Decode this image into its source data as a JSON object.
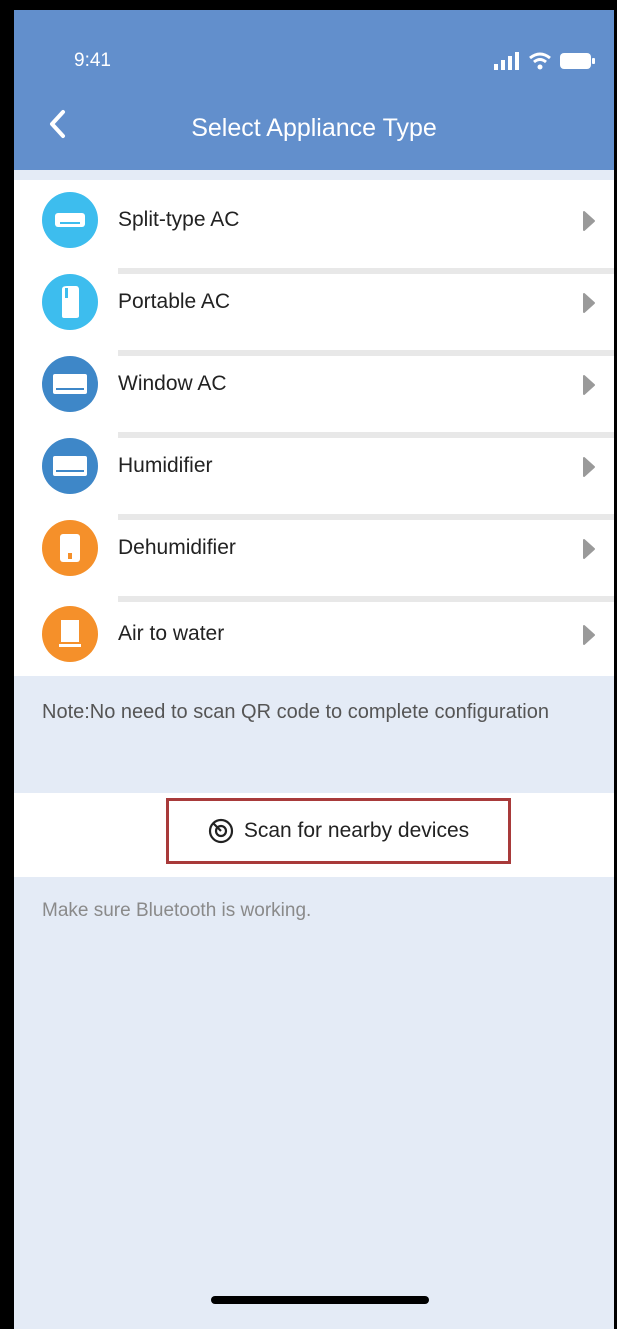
{
  "status_bar": {
    "time": "9:41"
  },
  "header": {
    "title": "Select Appliance Type"
  },
  "appliances": [
    {
      "label": "Split-type AC",
      "icon": "split-ac-icon",
      "color": "#3dbdee"
    },
    {
      "label": "Portable AC",
      "icon": "portable-ac-icon",
      "color": "#3dbdee"
    },
    {
      "label": "Window AC",
      "icon": "window-ac-icon",
      "color": "#3e87c8"
    },
    {
      "label": "Humidifier",
      "icon": "humidifier-icon",
      "color": "#3e87c8"
    },
    {
      "label": "Dehumidifier",
      "icon": "dehumidifier-icon",
      "color": "#f5902a"
    },
    {
      "label": "Air to water",
      "icon": "air-to-water-icon",
      "color": "#f5902a"
    }
  ],
  "note": "Note:No need to scan QR code to complete configuration",
  "scan": {
    "label": "Scan for nearby devices"
  },
  "hint": "Make sure Bluetooth is working.",
  "colors": {
    "header": "#628fcc",
    "background": "#e4ebf6",
    "highlight": "#a83a3a"
  }
}
